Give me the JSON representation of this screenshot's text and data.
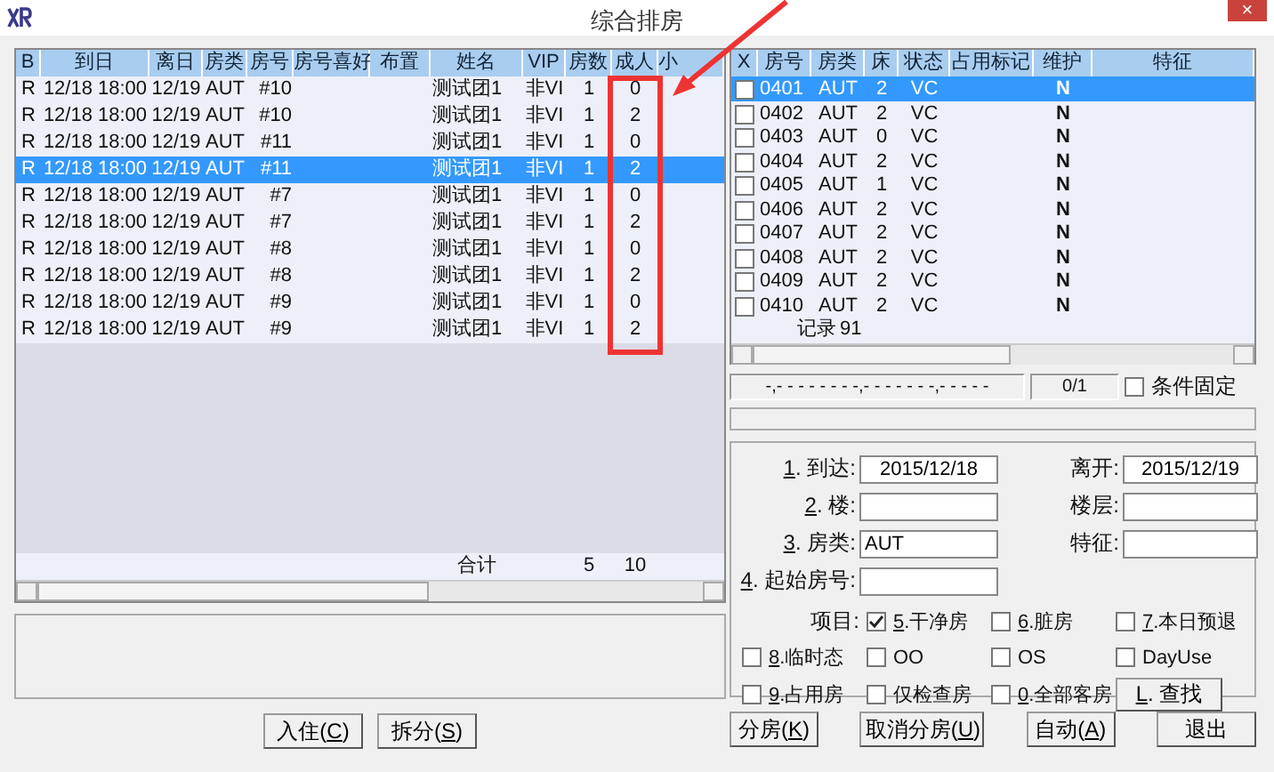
{
  "window": {
    "title": "综合排房",
    "close": "×"
  },
  "guest_table": {
    "columns": [
      "B",
      "到日",
      "离日",
      "房类",
      "房号",
      "房号喜好",
      "布置",
      "姓名",
      "VIP",
      "房数",
      "成人",
      "小"
    ],
    "rows": [
      {
        "flag": "R",
        "arrive": "12/18 18:00",
        "depart": "12/19",
        "type": "AUT",
        "room": "#10",
        "name": "测试团1",
        "vip": "非VI",
        "rooms": "1",
        "adults": "0",
        "selected": false
      },
      {
        "flag": "R",
        "arrive": "12/18 18:00",
        "depart": "12/19",
        "type": "AUT",
        "room": "#10",
        "name": "测试团1",
        "vip": "非VI",
        "rooms": "1",
        "adults": "2",
        "selected": false
      },
      {
        "flag": "R",
        "arrive": "12/18 18:00",
        "depart": "12/19",
        "type": "AUT",
        "room": "#11",
        "name": "测试团1",
        "vip": "非VI",
        "rooms": "1",
        "adults": "0",
        "selected": false
      },
      {
        "flag": "R",
        "arrive": "12/18 18:00",
        "depart": "12/19",
        "type": "AUT",
        "room": "#11",
        "name": "测试团1",
        "vip": "非VI",
        "rooms": "1",
        "adults": "2",
        "selected": true
      },
      {
        "flag": "R",
        "arrive": "12/18 18:00",
        "depart": "12/19",
        "type": "AUT",
        "room": "#7",
        "name": "测试团1",
        "vip": "非VI",
        "rooms": "1",
        "adults": "0",
        "selected": false
      },
      {
        "flag": "R",
        "arrive": "12/18 18:00",
        "depart": "12/19",
        "type": "AUT",
        "room": "#7",
        "name": "测试团1",
        "vip": "非VI",
        "rooms": "1",
        "adults": "2",
        "selected": false
      },
      {
        "flag": "R",
        "arrive": "12/18 18:00",
        "depart": "12/19",
        "type": "AUT",
        "room": "#8",
        "name": "测试团1",
        "vip": "非VI",
        "rooms": "1",
        "adults": "0",
        "selected": false
      },
      {
        "flag": "R",
        "arrive": "12/18 18:00",
        "depart": "12/19",
        "type": "AUT",
        "room": "#8",
        "name": "测试团1",
        "vip": "非VI",
        "rooms": "1",
        "adults": "2",
        "selected": false
      },
      {
        "flag": "R",
        "arrive": "12/18 18:00",
        "depart": "12/19",
        "type": "AUT",
        "room": "#9",
        "name": "测试团1",
        "vip": "非VI",
        "rooms": "1",
        "adults": "0",
        "selected": false
      },
      {
        "flag": "R",
        "arrive": "12/18 18:00",
        "depart": "12/19",
        "type": "AUT",
        "room": "#9",
        "name": "测试团1",
        "vip": "非VI",
        "rooms": "1",
        "adults": "2",
        "selected": false
      }
    ],
    "total": {
      "label": "合计",
      "rooms": "5",
      "adults": "10"
    }
  },
  "left_buttons": [
    {
      "label": "入住(",
      "accel": "C",
      "tail": ")"
    },
    {
      "label": "拆分(",
      "accel": "S",
      "tail": ")"
    }
  ],
  "room_table": {
    "columns": [
      "X",
      "房号",
      "房类",
      "床",
      "状态",
      "占用标记",
      "维护",
      "特征"
    ],
    "rows": [
      {
        "room": "0401",
        "type": "AUT",
        "beds": "2",
        "status": "VC",
        "maint": "N",
        "checked": false,
        "selected": true
      },
      {
        "room": "0402",
        "type": "AUT",
        "beds": "2",
        "status": "VC",
        "maint": "N",
        "checked": false,
        "selected": false
      },
      {
        "room": "0403",
        "type": "AUT",
        "beds": "0",
        "status": "VC",
        "maint": "N",
        "checked": false,
        "selected": false
      },
      {
        "room": "0404",
        "type": "AUT",
        "beds": "2",
        "status": "VC",
        "maint": "N",
        "checked": false,
        "selected": false
      },
      {
        "room": "0405",
        "type": "AUT",
        "beds": "1",
        "status": "VC",
        "maint": "N",
        "checked": false,
        "selected": false
      },
      {
        "room": "0406",
        "type": "AUT",
        "beds": "2",
        "status": "VC",
        "maint": "N",
        "checked": false,
        "selected": false
      },
      {
        "room": "0407",
        "type": "AUT",
        "beds": "2",
        "status": "VC",
        "maint": "N",
        "checked": false,
        "selected": false
      },
      {
        "room": "0408",
        "type": "AUT",
        "beds": "2",
        "status": "VC",
        "maint": "N",
        "checked": false,
        "selected": false
      },
      {
        "room": "0409",
        "type": "AUT",
        "beds": "2",
        "status": "VC",
        "maint": "N",
        "checked": false,
        "selected": false
      },
      {
        "room": "0410",
        "type": "AUT",
        "beds": "2",
        "status": "VC",
        "maint": "N",
        "checked": false,
        "selected": false
      }
    ],
    "record_label": "记录",
    "record_count": "91"
  },
  "filter_status": {
    "mask": "-,- - - - - - - -,- - - - - - -,- - - - -",
    "page": "0/1",
    "fixed_label": "条件固定",
    "fixed_checked": false
  },
  "form": {
    "fields": [
      {
        "accel": "1",
        "label": ". 到达:",
        "value": "2015/12/18",
        "center": true
      },
      {
        "label": "离开:",
        "value": "2015/12/19",
        "center": true
      },
      {
        "accel": "2",
        "label": ". 楼:"
      },
      {
        "label": "楼层:"
      },
      {
        "accel": "3",
        "label": ". 房类:",
        "value": "AUT",
        "center": false
      },
      {
        "label": "特征:"
      },
      {
        "accel": "4",
        "label": ". 起始房号:"
      }
    ],
    "options": [
      {
        "kind": "label",
        "label": "项目:"
      },
      {
        "kind": "checkbox",
        "accel": "5",
        "label": ".干净房",
        "checked": true
      },
      {
        "kind": "checkbox",
        "accel": "6",
        "label": ".脏房",
        "checked": false
      },
      {
        "kind": "checkbox",
        "accel": "7",
        "label": ".本日预退",
        "checked": false
      },
      {
        "kind": "checkbox",
        "accel": "8",
        "label": ".临时态",
        "checked": false
      },
      {
        "kind": "checkbox",
        "label": "OO",
        "checked": false
      },
      {
        "kind": "checkbox",
        "label": "OS",
        "checked": false
      },
      {
        "kind": "checkbox",
        "label": "DayUse",
        "checked": false
      },
      {
        "kind": "checkbox",
        "accel": "9",
        "label": ".占用房",
        "checked": false
      },
      {
        "kind": "checkbox",
        "label": "仅检查房",
        "checked": false
      },
      {
        "kind": "checkbox",
        "accel": "0",
        "label": ".全部客房",
        "checked": false
      },
      {
        "kind": "button",
        "accel": "L",
        "label": ". 查找"
      }
    ]
  },
  "right_buttons": [
    {
      "label": "分房(",
      "accel": "K",
      "tail": ")"
    },
    {
      "label": "取消分房(",
      "accel": "U",
      "tail": ")"
    },
    {
      "label": "自动(",
      "accel": "A",
      "tail": ")"
    },
    {
      "label": "退出"
    }
  ]
}
